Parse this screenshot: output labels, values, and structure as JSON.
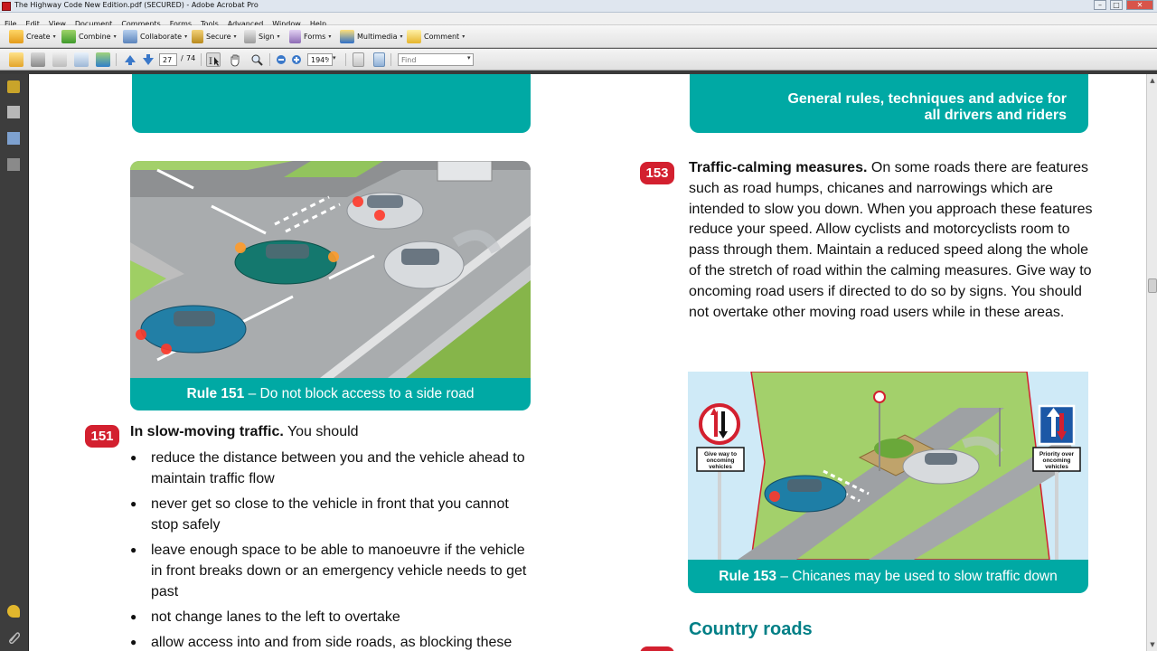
{
  "window": {
    "title": "The Highway Code New Edition.pdf (SECURED) - Adobe Acrobat Pro",
    "minimize_glyph": "–",
    "maximize_glyph": "□",
    "close_glyph": "✕"
  },
  "menu": [
    "File",
    "Edit",
    "View",
    "Document",
    "Comments",
    "Forms",
    "Tools",
    "Advanced",
    "Window",
    "Help"
  ],
  "task_toolbar": {
    "create": "Create",
    "combine": "Combine",
    "collaborate": "Collaborate",
    "secure": "Secure",
    "sign": "Sign",
    "forms": "Forms",
    "multimedia": "Multimedia",
    "comment": "Comment",
    "dropdown_glyph": "▾"
  },
  "nav_toolbar": {
    "current_page": "27",
    "page_separator": "/",
    "total_pages": "74",
    "zoom": "194%",
    "find_placeholder": "Find",
    "dropdown_glyph": "▾"
  },
  "scrollbar": {
    "up_glyph": "▲",
    "down_glyph": "▼"
  },
  "page": {
    "section_header": {
      "line1": "General rules, techniques and advice for",
      "line2": "all drivers and riders"
    },
    "fig151": {
      "rule": "Rule 151",
      "text": " – Do not block access to a side road"
    },
    "rule151": {
      "number": "151",
      "lead": "In slow-moving traffic.",
      "lead_rest": " You should",
      "bullets": [
        "reduce the distance between you and the vehicle ahead to maintain traffic flow",
        "never get so close to the vehicle in front that you cannot stop safely",
        "leave enough space to be able to manoeuvre if the vehicle in front breaks down or an emergency vehicle needs to get past",
        "not change lanes to the left to overtake",
        "allow access into and from side roads, as blocking these"
      ]
    },
    "rule153": {
      "number": "153",
      "lead": "Traffic-calming measures.",
      "text": " On some roads there are features such as road humps, chicanes and narrowings which are intended to slow you down. When you approach these features reduce your speed. Allow cyclists and motorcyclists room to pass through them. Maintain a reduced speed along the whole of the stretch of road within the calming measures. Give way to oncoming road users if directed to do so by signs. You should not overtake other moving road users while in these areas."
    },
    "fig153": {
      "rule": "Rule 153",
      "text": " – Chicanes may be used to slow traffic down",
      "sign_left": [
        "Give way to",
        "oncoming",
        "vehicles"
      ],
      "sign_right": [
        "Priority over",
        "oncoming",
        "vehicles"
      ]
    },
    "country_roads": "Country roads"
  },
  "colors": {
    "teal": "#00a9a4",
    "rule_red": "#d3202f",
    "heading_teal": "#007f86"
  }
}
